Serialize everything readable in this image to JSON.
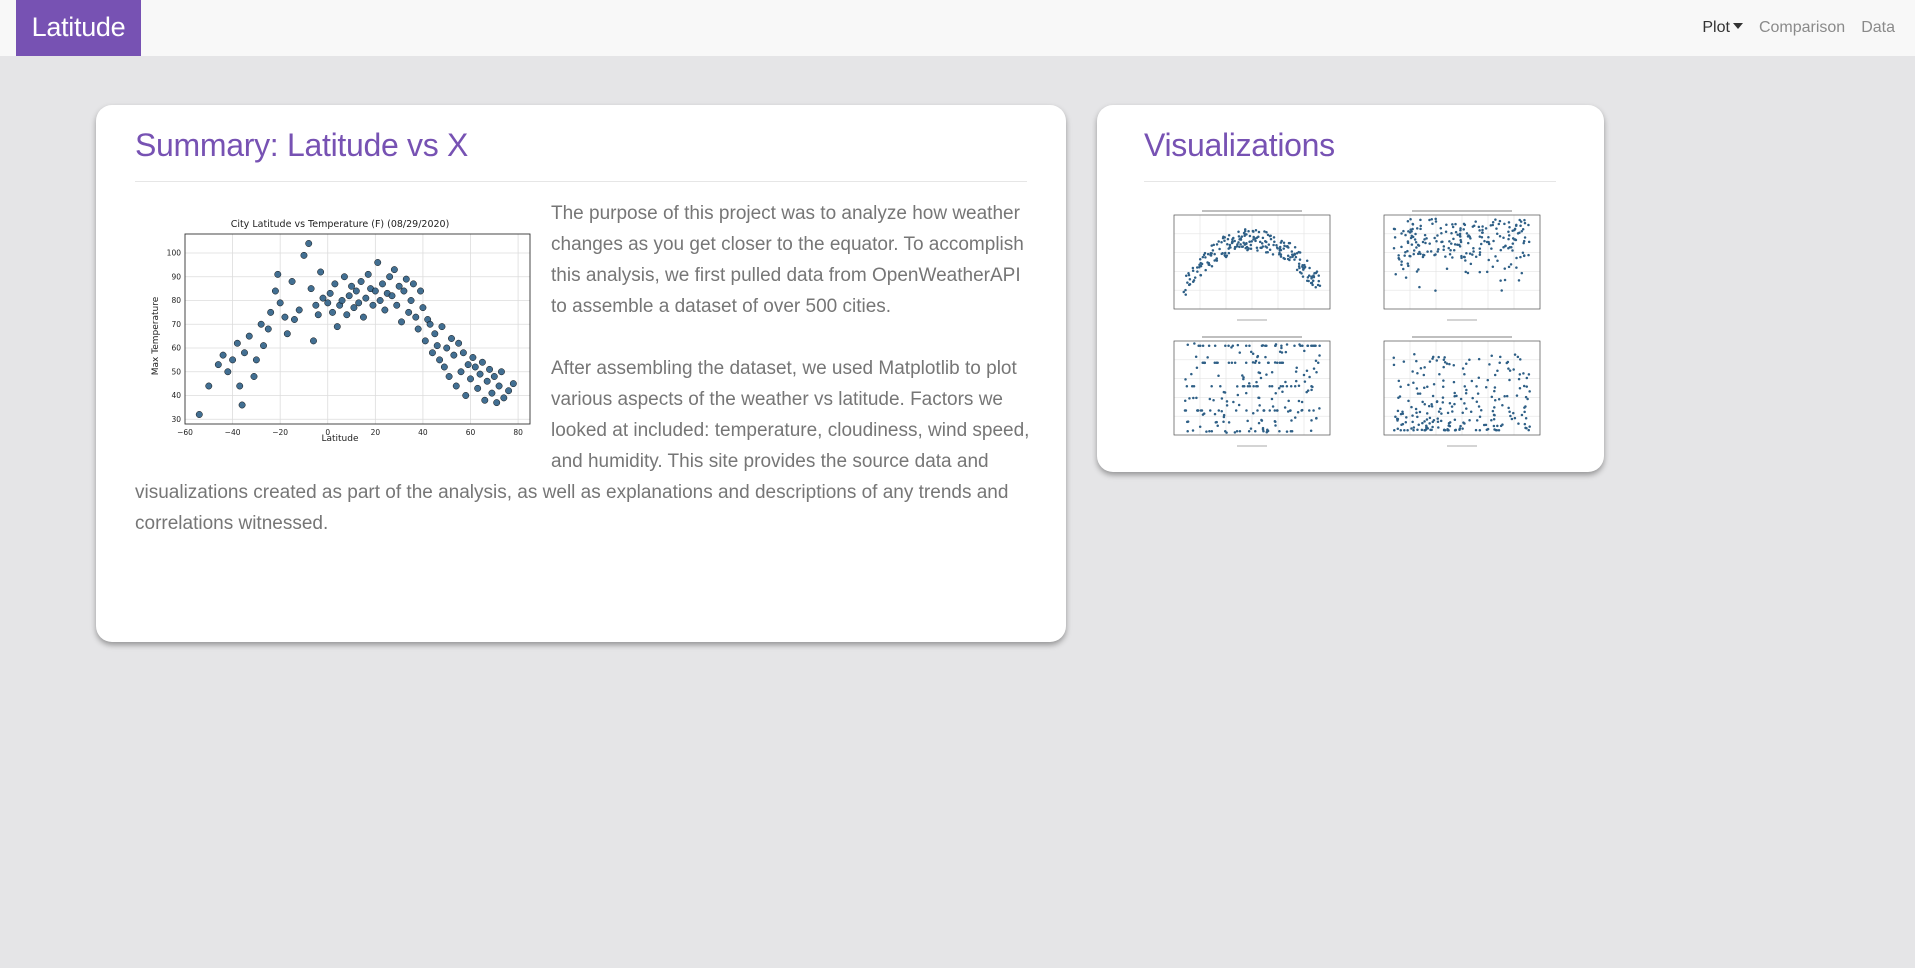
{
  "navbar": {
    "brand": "Latitude",
    "links": [
      {
        "label": "Plot",
        "dropdown": true
      },
      {
        "label": "Comparison"
      },
      {
        "label": "Data"
      }
    ]
  },
  "summary": {
    "title": "Summary: Latitude vs X",
    "paragraphs": [
      "The purpose of this project was to analyze how weather changes as you get closer to the equator. To accomplish this analysis, we first pulled data from OpenWeatherAPI to assemble a dataset of over 500 cities.",
      "After assembling the dataset, we used Matplotlib to plot various aspects of the weather vs latitude. Factors we looked at included: temperature, cloudiness, wind speed, and humidity. This site provides the source data and visualizations created as part of the analysis, as well as explanations and descriptions of any trends and correlations witnessed."
    ]
  },
  "visualizations": {
    "title": "Visualizations"
  },
  "colors": {
    "accent": "#7752b3",
    "marker": "#2e5f86",
    "background": "#e5e5e7"
  },
  "chart_data": [
    {
      "type": "scatter",
      "title": "City Latitude vs Temperature (F) (08/29/2020)",
      "xlabel": "Latitude",
      "ylabel": "Max Temperature",
      "xlim": [
        -60,
        85
      ],
      "ylim": [
        28,
        108
      ],
      "xticks": [
        -60,
        -40,
        -20,
        0,
        20,
        40,
        60,
        80
      ],
      "yticks": [
        30,
        40,
        50,
        60,
        70,
        80,
        90,
        100
      ],
      "grid": true,
      "points_approx": [
        [
          -54,
          32
        ],
        [
          -50,
          44
        ],
        [
          -46,
          53
        ],
        [
          -44,
          57
        ],
        [
          -42,
          50
        ],
        [
          -40,
          55
        ],
        [
          -38,
          62
        ],
        [
          -37,
          44
        ],
        [
          -36,
          36
        ],
        [
          -35,
          58
        ],
        [
          -33,
          65
        ],
        [
          -31,
          48
        ],
        [
          -30,
          55
        ],
        [
          -28,
          70
        ],
        [
          -27,
          61
        ],
        [
          -25,
          68
        ],
        [
          -24,
          75
        ],
        [
          -22,
          84
        ],
        [
          -21,
          91
        ],
        [
          -20,
          79
        ],
        [
          -18,
          73
        ],
        [
          -17,
          66
        ],
        [
          -15,
          88
        ],
        [
          -14,
          72
        ],
        [
          -12,
          76
        ],
        [
          -10,
          99
        ],
        [
          -8,
          104
        ],
        [
          -7,
          85
        ],
        [
          -6,
          63
        ],
        [
          -5,
          78
        ],
        [
          -4,
          74
        ],
        [
          -3,
          92
        ],
        [
          -2,
          81
        ],
        [
          0,
          79
        ],
        [
          1,
          83
        ],
        [
          2,
          75
        ],
        [
          3,
          87
        ],
        [
          4,
          69
        ],
        [
          5,
          78
        ],
        [
          6,
          80
        ],
        [
          7,
          90
        ],
        [
          8,
          74
        ],
        [
          9,
          82
        ],
        [
          10,
          86
        ],
        [
          11,
          77
        ],
        [
          12,
          84
        ],
        [
          13,
          79
        ],
        [
          14,
          88
        ],
        [
          15,
          73
        ],
        [
          16,
          81
        ],
        [
          17,
          91
        ],
        [
          18,
          85
        ],
        [
          19,
          78
        ],
        [
          20,
          84
        ],
        [
          21,
          96
        ],
        [
          22,
          80
        ],
        [
          23,
          87
        ],
        [
          24,
          76
        ],
        [
          25,
          83
        ],
        [
          26,
          90
        ],
        [
          27,
          82
        ],
        [
          28,
          93
        ],
        [
          29,
          78
        ],
        [
          30,
          86
        ],
        [
          31,
          71
        ],
        [
          32,
          84
        ],
        [
          33,
          89
        ],
        [
          34,
          75
        ],
        [
          35,
          80
        ],
        [
          36,
          87
        ],
        [
          37,
          73
        ],
        [
          38,
          68
        ],
        [
          39,
          84
        ],
        [
          40,
          77
        ],
        [
          41,
          63
        ],
        [
          42,
          72
        ],
        [
          43,
          70
        ],
        [
          44,
          58
        ],
        [
          45,
          66
        ],
        [
          46,
          61
        ],
        [
          47,
          55
        ],
        [
          48,
          69
        ],
        [
          49,
          52
        ],
        [
          50,
          60
        ],
        [
          51,
          48
        ],
        [
          52,
          64
        ],
        [
          53,
          57
        ],
        [
          54,
          44
        ],
        [
          55,
          62
        ],
        [
          56,
          50
        ],
        [
          57,
          58
        ],
        [
          58,
          40
        ],
        [
          59,
          53
        ],
        [
          60,
          47
        ],
        [
          61,
          56
        ],
        [
          62,
          52
        ],
        [
          63,
          43
        ],
        [
          64,
          49
        ],
        [
          65,
          54
        ],
        [
          66,
          38
        ],
        [
          67,
          46
        ],
        [
          68,
          51
        ],
        [
          69,
          41
        ],
        [
          70,
          48
        ],
        [
          71,
          37
        ],
        [
          72,
          44
        ],
        [
          73,
          50
        ],
        [
          74,
          39
        ],
        [
          76,
          42
        ],
        [
          78,
          45
        ]
      ]
    }
  ]
}
